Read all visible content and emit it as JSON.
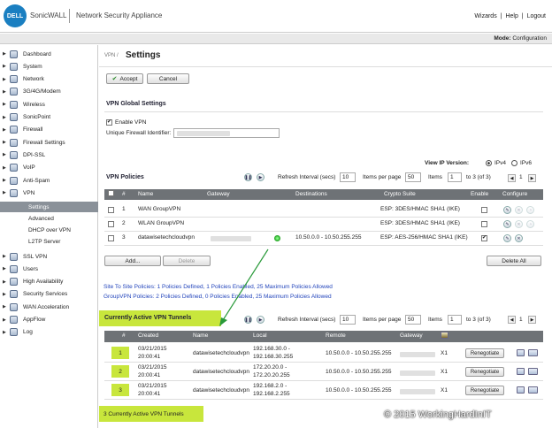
{
  "header": {
    "logo": "DELL",
    "brand": "SonicWALL",
    "product": "Network Security Appliance",
    "links": [
      "Wizards",
      "|",
      "Help",
      "|",
      "Logout"
    ]
  },
  "modebar": {
    "mode_label": "Mode:",
    "mode_value": "Configuration"
  },
  "sidebar": {
    "items": [
      {
        "label": "Dashboard",
        "icon": "dashboard-icon"
      },
      {
        "label": "System",
        "icon": "system-icon"
      },
      {
        "label": "Network",
        "icon": "network-icon"
      },
      {
        "label": "3G/4G/Modem",
        "icon": "modem-icon"
      },
      {
        "label": "Wireless",
        "icon": "wireless-icon"
      },
      {
        "label": "SonicPoint",
        "icon": "sonicpoint-icon"
      },
      {
        "label": "Firewall",
        "icon": "firewall-icon"
      },
      {
        "label": "Firewall Settings",
        "icon": "firewall-settings-icon"
      },
      {
        "label": "DPI-SSL",
        "icon": "dpi-ssl-icon"
      },
      {
        "label": "VoIP",
        "icon": "voip-icon"
      },
      {
        "label": "Anti-Spam",
        "icon": "anti-spam-icon"
      },
      {
        "label": "VPN",
        "icon": "vpn-icon"
      }
    ],
    "vpn_sub": [
      "Settings",
      "Advanced",
      "DHCP over VPN",
      "L2TP Server"
    ],
    "items2": [
      {
        "label": "SSL VPN",
        "icon": "ssl-vpn-icon"
      },
      {
        "label": "Users",
        "icon": "users-icon"
      },
      {
        "label": "High Availability",
        "icon": "high-availability-icon"
      },
      {
        "label": "Security Services",
        "icon": "security-services-icon"
      },
      {
        "label": "WAN Acceleration",
        "icon": "wan-acceleration-icon"
      },
      {
        "label": "AppFlow",
        "icon": "appflow-icon"
      },
      {
        "label": "Log",
        "icon": "log-icon"
      }
    ]
  },
  "page": {
    "breadcrumb": "VPN /",
    "title": "Settings",
    "accept": "Accept",
    "cancel": "Cancel"
  },
  "global": {
    "title": "VPN Global Settings",
    "enable_label": "Enable VPN",
    "uid_label": "Unique Firewall Identifier:"
  },
  "view_ip": {
    "label": "View IP Version:",
    "ipv4": "IPv4",
    "ipv6": "IPv6"
  },
  "policies": {
    "title": "VPN Policies",
    "refresh_label": "Refresh Interval (secs)",
    "refresh_value": "10",
    "items_per_page_label": "Items per page",
    "items_per_page": "50",
    "items_label": "Items",
    "items_value": "1",
    "range": "to 3 (of 3)",
    "page": "1",
    "columns": [
      "#",
      "Name",
      "Gateway",
      "Destinations",
      "Crypto Suite",
      "Enable",
      "Configure"
    ],
    "rows": [
      {
        "num": "1",
        "name": "WAN GroupVPN",
        "dest": "",
        "crypto": "ESP: 3DES/HMAC SHA1 (IKE)",
        "enabled": false
      },
      {
        "num": "2",
        "name": "WLAN GroupVPN",
        "dest": "",
        "crypto": "ESP: 3DES/HMAC SHA1 (IKE)",
        "enabled": false
      },
      {
        "num": "3",
        "name": "datawisetechcloudvpn",
        "dest": "10.50.0.0 - 10.50.255.255",
        "crypto": "ESP: AES-256/HMAC SHA1 (IKE)",
        "enabled": true
      }
    ],
    "add": "Add...",
    "delete": "Delete",
    "delete_all": "Delete All",
    "summary1": "Site To Site Policies: 1 Policies Defined, 1 Policies Enabled, 25 Maximum Policies Allowed",
    "summary2": "GroupVPN Policies: 2 Policies Defined, 0 Policies Enabled, 25 Maximum Policies Allowed"
  },
  "tunnels": {
    "title": "Currently Active VPN Tunnels",
    "refresh_label": "Refresh Interval (secs)",
    "refresh_value": "10",
    "items_per_page_label": "Items per page",
    "items_per_page": "50",
    "items_label": "Items",
    "items_value": "1",
    "range": "to 3 (of 3)",
    "page": "1",
    "columns": [
      "#",
      "Created",
      "Name",
      "Local",
      "Remote",
      "Gateway"
    ],
    "rows": [
      {
        "num": "1",
        "created1": "03/21/2015",
        "created2": "20:00:41",
        "name": "datawisetechcloudvpn",
        "local1": "192.168.30.0 -",
        "local2": "192.168.30.255",
        "remote": "10.50.0.0 - 10.50.255.255",
        "gw": "X1",
        "action": "Renegotiate"
      },
      {
        "num": "2",
        "created1": "03/21/2015",
        "created2": "20:00:41",
        "name": "datawisetechcloudvpn",
        "local1": "172.20.20.0 -",
        "local2": "172.20.20.255",
        "remote": "10.50.0.0 - 10.50.255.255",
        "gw": "X1",
        "action": "Renegotiate"
      },
      {
        "num": "3",
        "created1": "03/21/2015",
        "created2": "20:00:41",
        "name": "datawisetechcloudvpn",
        "local1": "192.168.2.0 -",
        "local2": "192.168.2.255",
        "remote": "10.50.0.0 - 10.50.255.255",
        "gw": "X1",
        "action": "Renegotiate"
      }
    ],
    "footer": "3 Currently Active VPN Tunnels"
  },
  "watermark": "© 2015 WorkingHardInIT",
  "colors": {
    "highlight": "#c8e63c",
    "arrow": "#2a9a3a",
    "table_header": "#6e7276",
    "link": "#2244bb"
  }
}
